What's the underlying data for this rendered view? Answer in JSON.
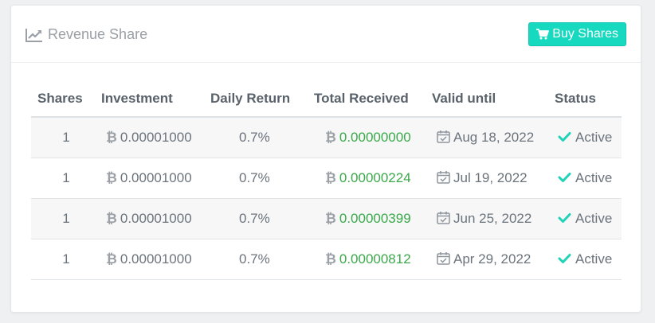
{
  "panel": {
    "title": "Revenue Share",
    "title_icon": "line-chart-icon",
    "buy_button_label": "Buy Shares",
    "buy_button_icon": "shopping-cart-icon",
    "accent_color": "#16d9c0",
    "received_color": "#3aa94a",
    "status_color": "#1fd3b8"
  },
  "table": {
    "headers": [
      "Shares",
      "Investment",
      "Daily Return",
      "Total Received",
      "Valid until",
      "Status"
    ],
    "rows": [
      {
        "shares": "1",
        "investment": "0.00001000",
        "daily": "0.7%",
        "received": "0.00000000",
        "valid": "Aug 18, 2022",
        "status": "Active"
      },
      {
        "shares": "1",
        "investment": "0.00001000",
        "daily": "0.7%",
        "received": "0.00000224",
        "valid": "Jul 19, 2022",
        "status": "Active"
      },
      {
        "shares": "1",
        "investment": "0.00001000",
        "daily": "0.7%",
        "received": "0.00000399",
        "valid": "Jun 25, 2022",
        "status": "Active"
      },
      {
        "shares": "1",
        "investment": "0.00001000",
        "daily": "0.7%",
        "received": "0.00000812",
        "valid": "Apr 29, 2022",
        "status": "Active"
      }
    ]
  }
}
